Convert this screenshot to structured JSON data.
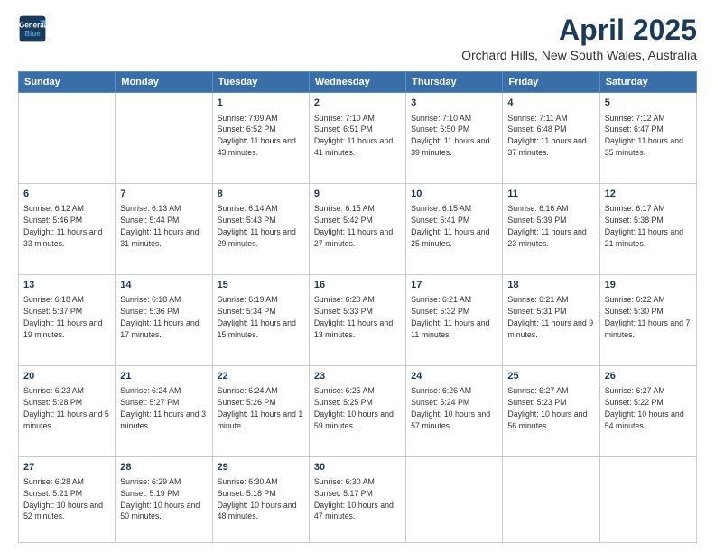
{
  "header": {
    "logo_line1": "General",
    "logo_line2": "Blue",
    "month": "April 2025",
    "location": "Orchard Hills, New South Wales, Australia"
  },
  "weekdays": [
    "Sunday",
    "Monday",
    "Tuesday",
    "Wednesday",
    "Thursday",
    "Friday",
    "Saturday"
  ],
  "weeks": [
    [
      {
        "day": "",
        "text": ""
      },
      {
        "day": "",
        "text": ""
      },
      {
        "day": "1",
        "text": "Sunrise: 7:09 AM\nSunset: 6:52 PM\nDaylight: 11 hours and 43 minutes."
      },
      {
        "day": "2",
        "text": "Sunrise: 7:10 AM\nSunset: 6:51 PM\nDaylight: 11 hours and 41 minutes."
      },
      {
        "day": "3",
        "text": "Sunrise: 7:10 AM\nSunset: 6:50 PM\nDaylight: 11 hours and 39 minutes."
      },
      {
        "day": "4",
        "text": "Sunrise: 7:11 AM\nSunset: 6:48 PM\nDaylight: 11 hours and 37 minutes."
      },
      {
        "day": "5",
        "text": "Sunrise: 7:12 AM\nSunset: 6:47 PM\nDaylight: 11 hours and 35 minutes."
      }
    ],
    [
      {
        "day": "6",
        "text": "Sunrise: 6:12 AM\nSunset: 5:46 PM\nDaylight: 11 hours and 33 minutes."
      },
      {
        "day": "7",
        "text": "Sunrise: 6:13 AM\nSunset: 5:44 PM\nDaylight: 11 hours and 31 minutes."
      },
      {
        "day": "8",
        "text": "Sunrise: 6:14 AM\nSunset: 5:43 PM\nDaylight: 11 hours and 29 minutes."
      },
      {
        "day": "9",
        "text": "Sunrise: 6:15 AM\nSunset: 5:42 PM\nDaylight: 11 hours and 27 minutes."
      },
      {
        "day": "10",
        "text": "Sunrise: 6:15 AM\nSunset: 5:41 PM\nDaylight: 11 hours and 25 minutes."
      },
      {
        "day": "11",
        "text": "Sunrise: 6:16 AM\nSunset: 5:39 PM\nDaylight: 11 hours and 23 minutes."
      },
      {
        "day": "12",
        "text": "Sunrise: 6:17 AM\nSunset: 5:38 PM\nDaylight: 11 hours and 21 minutes."
      }
    ],
    [
      {
        "day": "13",
        "text": "Sunrise: 6:18 AM\nSunset: 5:37 PM\nDaylight: 11 hours and 19 minutes."
      },
      {
        "day": "14",
        "text": "Sunrise: 6:18 AM\nSunset: 5:36 PM\nDaylight: 11 hours and 17 minutes."
      },
      {
        "day": "15",
        "text": "Sunrise: 6:19 AM\nSunset: 5:34 PM\nDaylight: 11 hours and 15 minutes."
      },
      {
        "day": "16",
        "text": "Sunrise: 6:20 AM\nSunset: 5:33 PM\nDaylight: 11 hours and 13 minutes."
      },
      {
        "day": "17",
        "text": "Sunrise: 6:21 AM\nSunset: 5:32 PM\nDaylight: 11 hours and 11 minutes."
      },
      {
        "day": "18",
        "text": "Sunrise: 6:21 AM\nSunset: 5:31 PM\nDaylight: 11 hours and 9 minutes."
      },
      {
        "day": "19",
        "text": "Sunrise: 6:22 AM\nSunset: 5:30 PM\nDaylight: 11 hours and 7 minutes."
      }
    ],
    [
      {
        "day": "20",
        "text": "Sunrise: 6:23 AM\nSunset: 5:28 PM\nDaylight: 11 hours and 5 minutes."
      },
      {
        "day": "21",
        "text": "Sunrise: 6:24 AM\nSunset: 5:27 PM\nDaylight: 11 hours and 3 minutes."
      },
      {
        "day": "22",
        "text": "Sunrise: 6:24 AM\nSunset: 5:26 PM\nDaylight: 11 hours and 1 minute."
      },
      {
        "day": "23",
        "text": "Sunrise: 6:25 AM\nSunset: 5:25 PM\nDaylight: 10 hours and 59 minutes."
      },
      {
        "day": "24",
        "text": "Sunrise: 6:26 AM\nSunset: 5:24 PM\nDaylight: 10 hours and 57 minutes."
      },
      {
        "day": "25",
        "text": "Sunrise: 6:27 AM\nSunset: 5:23 PM\nDaylight: 10 hours and 56 minutes."
      },
      {
        "day": "26",
        "text": "Sunrise: 6:27 AM\nSunset: 5:22 PM\nDaylight: 10 hours and 54 minutes."
      }
    ],
    [
      {
        "day": "27",
        "text": "Sunrise: 6:28 AM\nSunset: 5:21 PM\nDaylight: 10 hours and 52 minutes."
      },
      {
        "day": "28",
        "text": "Sunrise: 6:29 AM\nSunset: 5:19 PM\nDaylight: 10 hours and 50 minutes."
      },
      {
        "day": "29",
        "text": "Sunrise: 6:30 AM\nSunset: 5:18 PM\nDaylight: 10 hours and 48 minutes."
      },
      {
        "day": "30",
        "text": "Sunrise: 6:30 AM\nSunset: 5:17 PM\nDaylight: 10 hours and 47 minutes."
      },
      {
        "day": "",
        "text": ""
      },
      {
        "day": "",
        "text": ""
      },
      {
        "day": "",
        "text": ""
      }
    ]
  ]
}
